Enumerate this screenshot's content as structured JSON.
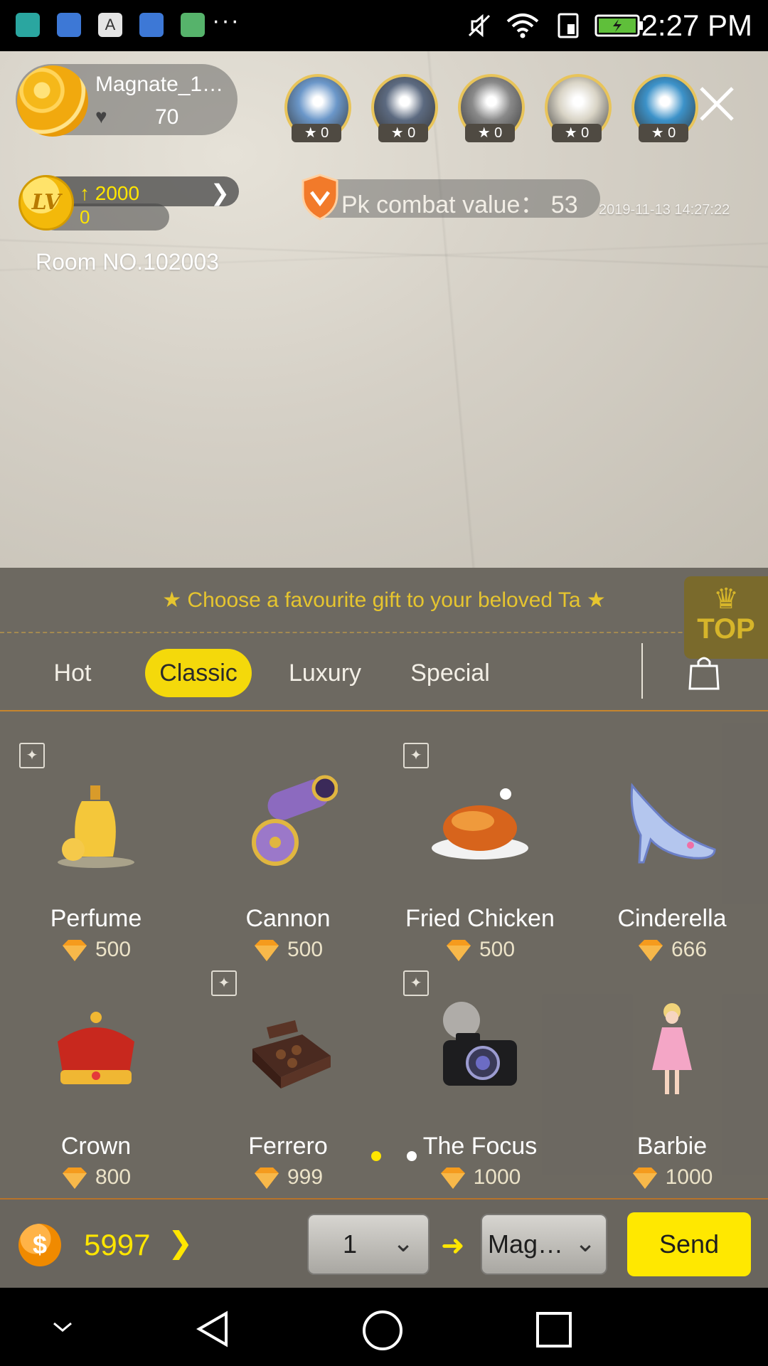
{
  "status_bar": {
    "time": "2:27 PM",
    "overflow": "···",
    "apps": [
      "android-debug-icon",
      "baidu-icon",
      "text-input-icon",
      "baidu-icon",
      "maps-icon"
    ]
  },
  "host": {
    "name": "Magnate_1…",
    "fans": "70"
  },
  "viewers": [
    {
      "badge": "★ 0",
      "color": "#6b97c9"
    },
    {
      "badge": "★ 0",
      "color": "#5c6a80"
    },
    {
      "badge": "★ 0",
      "color": "#8a8a8a"
    },
    {
      "badge": "★ 0",
      "color": "#d9d4c6"
    },
    {
      "badge": "★ 0",
      "color": "#3c92c9"
    }
  ],
  "level": {
    "badge": "LV",
    "target": "↑ 2000",
    "current": "0"
  },
  "room": "Room NO.102003",
  "pk": {
    "label": "Pk combat value： 53"
  },
  "timestamp": "2019-11-13 14:27:22",
  "gift_panel": {
    "tagline": "★  Choose a favourite gift to your beloved Ta  ★",
    "top_badge": "TOP",
    "tabs": [
      {
        "label": "Hot",
        "active": false
      },
      {
        "label": "Classic",
        "active": true
      },
      {
        "label": "Luxury",
        "active": false
      },
      {
        "label": "Special",
        "active": false
      }
    ],
    "gifts": [
      {
        "name": "Perfume",
        "price": "500",
        "emblem": true
      },
      {
        "name": "Cannon",
        "price": "500",
        "emblem": false
      },
      {
        "name": "Fried Chicken",
        "price": "500",
        "emblem": true
      },
      {
        "name": "Cinderella",
        "price": "666",
        "emblem": false
      },
      {
        "name": "Crown",
        "price": "800",
        "emblem": false
      },
      {
        "name": "Ferrero",
        "price": "999",
        "emblem": true
      },
      {
        "name": "The Focus",
        "price": "1000",
        "emblem": true
      },
      {
        "name": "Barbie",
        "price": "1000",
        "emblem": false
      }
    ],
    "pages": 2,
    "active_page": 1
  },
  "action_bar": {
    "balance": "5997",
    "quantity": "1",
    "recipient": "Magn…",
    "send_label": "Send"
  },
  "colors": {
    "accent_yellow": "#ffe800",
    "tab_active": "#f4d90b",
    "tagline_gold": "#e6c52f",
    "panel_bg": "#69655e"
  }
}
